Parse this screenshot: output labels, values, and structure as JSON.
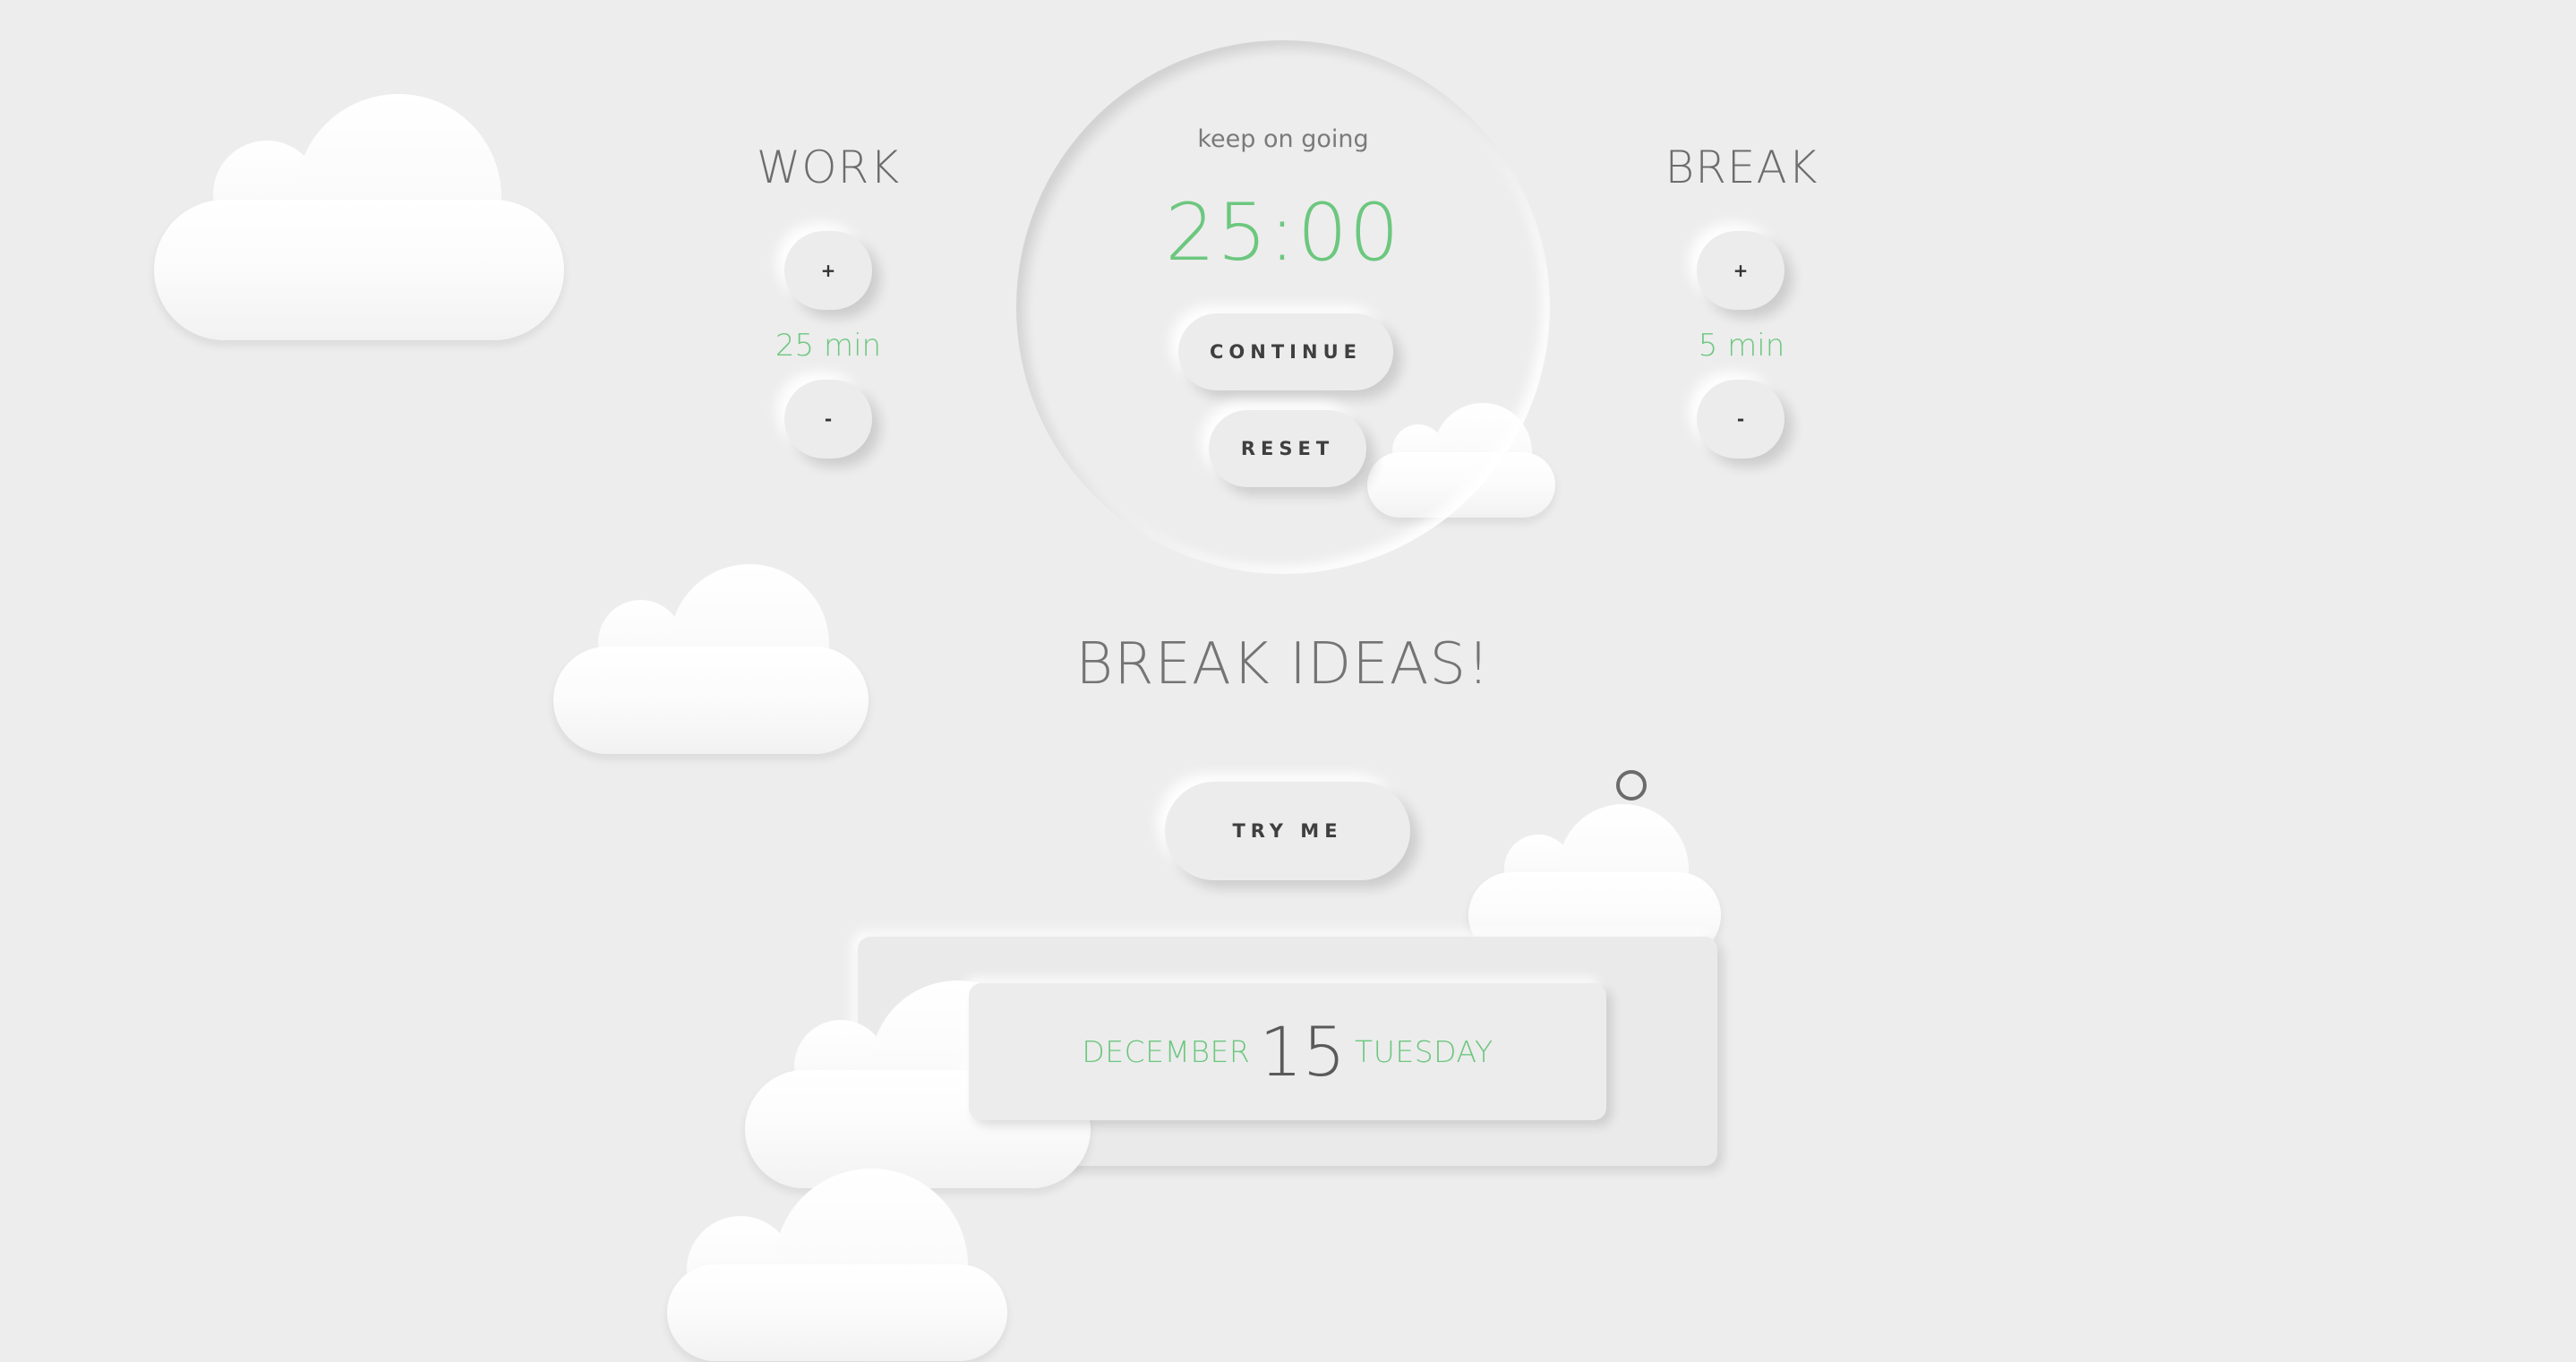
{
  "work": {
    "title": "WORK",
    "plus_label": "+",
    "minus_label": "-",
    "value": "25",
    "unit": "min"
  },
  "break": {
    "title": "BREAK",
    "plus_label": "+",
    "minus_label": "-",
    "value": "5",
    "unit": "min"
  },
  "timer": {
    "status": "keep on going",
    "time": "25:00",
    "continue_label": "CONTINUE",
    "reset_label": "RESET"
  },
  "break_ideas": {
    "heading": "BREAK IDEAS!",
    "try_label": "TRY ME"
  },
  "date": {
    "month": "DECEMBER",
    "day_number": "15",
    "weekday": "TUESDAY"
  },
  "colors": {
    "accent": "#6cc77f",
    "background": "#ededed",
    "text": "#6d6d6d"
  }
}
